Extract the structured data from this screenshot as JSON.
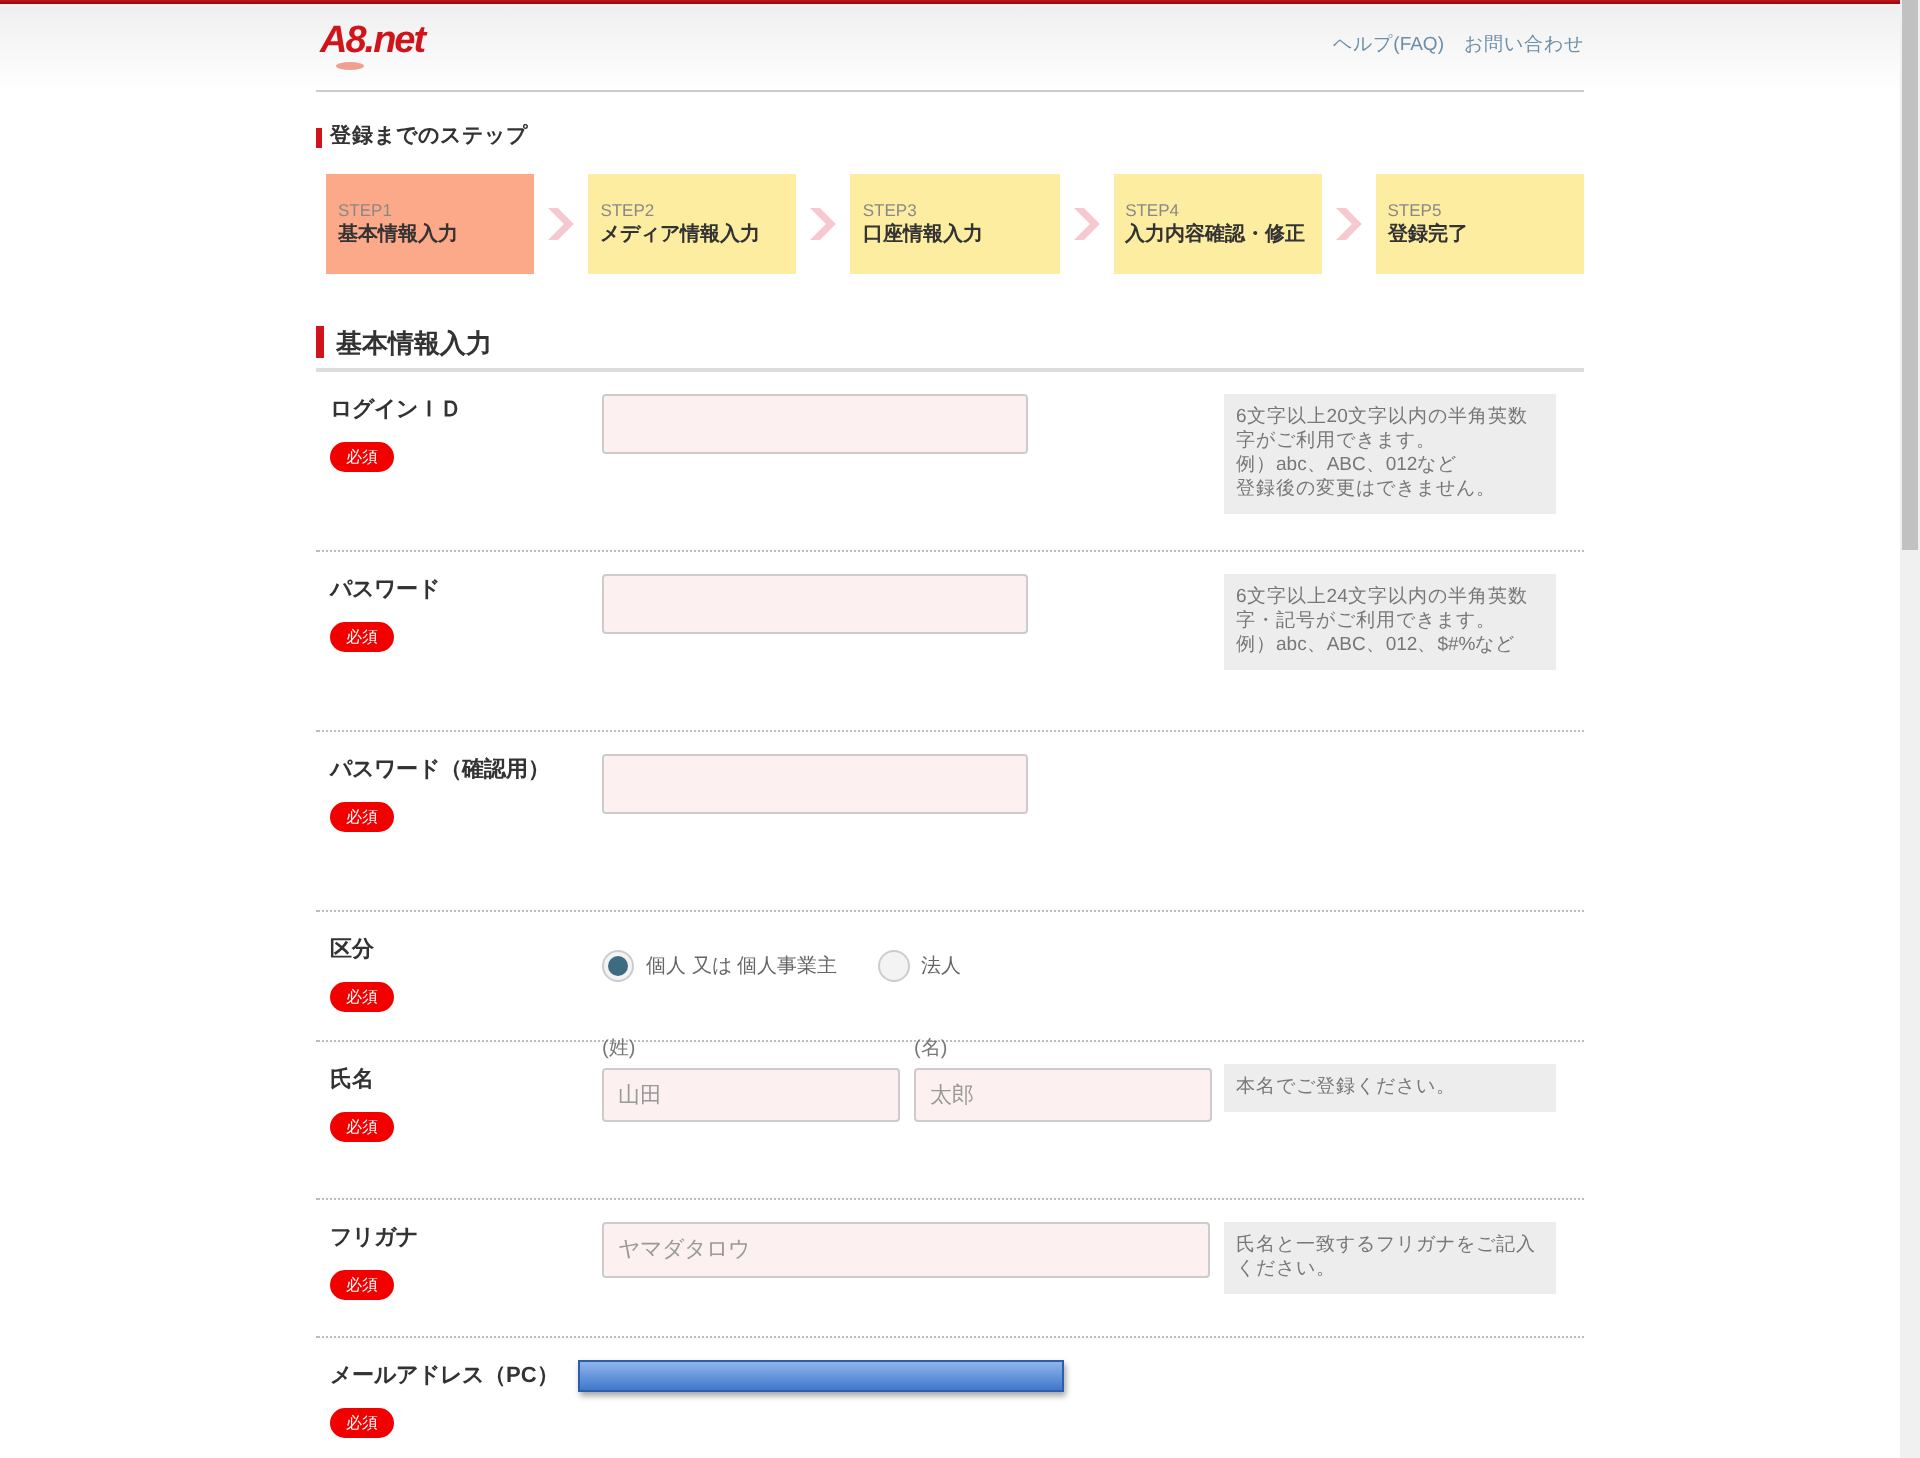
{
  "header": {
    "logo": "A8.net",
    "links": [
      "ヘルプ(FAQ)",
      "お問い合わせ"
    ]
  },
  "steps_title": "登録までのステップ",
  "steps": [
    {
      "label": "STEP1",
      "name": "基本情報入力",
      "selected": true
    },
    {
      "label": "STEP2",
      "name": "メディア情報入力",
      "selected": false
    },
    {
      "label": "STEP3",
      "name": "口座情報入力",
      "selected": false
    },
    {
      "label": "STEP4",
      "name": "入力内容確認・修正",
      "selected": false
    },
    {
      "label": "STEP5",
      "name": "登録完了",
      "selected": false
    }
  ],
  "section_title": "基本情報入力",
  "rows": [
    {
      "kind": "text",
      "label": "ログインＩＤ",
      "badge": "必須",
      "hint": [
        "6文字以上20文字以内の半角英数字がご利用できます。",
        "例）abc、ABC、012など",
        "登録後の変更はできません。"
      ]
    },
    {
      "kind": "text",
      "label": "パスワード",
      "badge": "必須",
      "hint": [
        "6文字以上24文字以内の半角英数字・記号がご利用できます。",
        "例）abc、ABC、012、$#%など"
      ]
    },
    {
      "kind": "text",
      "label": "パスワード（確認用）",
      "badge": "必須"
    },
    {
      "kind": "radio",
      "label": "区分",
      "badge": "必須",
      "options": [
        {
          "label": "個人 又は 個人事業主",
          "selected": true
        },
        {
          "label": "法人",
          "selected": false
        }
      ]
    },
    {
      "kind": "name",
      "label": "氏名",
      "badge": "必須",
      "fields": [
        {
          "caption": "(姓)",
          "placeholder": "山田"
        },
        {
          "caption": "(名)",
          "placeholder": "太郎"
        }
      ],
      "hint": [
        "本名でご登録ください。"
      ]
    },
    {
      "kind": "wide",
      "label": "フリガナ",
      "badge": "必須",
      "placeholder": "ヤマダタロウ",
      "hint": [
        "氏名と一致するフリガナをご記入ください。"
      ]
    },
    {
      "kind": "bar",
      "label": "メールアドレス（PC）",
      "badge": "必須"
    }
  ]
}
